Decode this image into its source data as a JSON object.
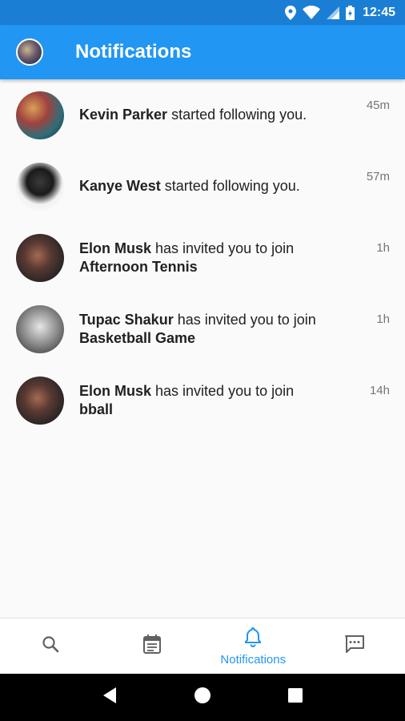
{
  "status_bar": {
    "time": "12:45",
    "icons": [
      "location-icon",
      "wifi-icon",
      "signal-icon",
      "battery-icon"
    ]
  },
  "app_bar": {
    "title": "Notifications",
    "avatar_icon": "profile-avatar"
  },
  "notifications": [
    {
      "actor": "Kevin Parker",
      "message": " started following you.",
      "target": "",
      "ago": "45m"
    },
    {
      "actor": "Kanye West",
      "message": " started following you.",
      "target": "",
      "ago": "57m"
    },
    {
      "actor": "Elon Musk",
      "message": " has invited you to join",
      "target": "Afternoon Tennis",
      "ago": "1h"
    },
    {
      "actor": "Tupac Shakur",
      "message": " has invited you to join",
      "target": "Basketball Game",
      "ago": "1h"
    },
    {
      "actor": "Elon Musk",
      "message": " has invited you to join",
      "target": "bball",
      "ago": "14h"
    }
  ],
  "bottom_nav": {
    "items": [
      {
        "icon": "search-icon",
        "label": ""
      },
      {
        "icon": "calendar-icon",
        "label": ""
      },
      {
        "icon": "bell-icon",
        "label": "Notifications"
      },
      {
        "icon": "chat-icon",
        "label": ""
      }
    ],
    "active_index": 2
  },
  "colors": {
    "primary": "#2196f3",
    "status_bar": "#1a7fd4",
    "text": "#212121",
    "muted": "#757575"
  }
}
